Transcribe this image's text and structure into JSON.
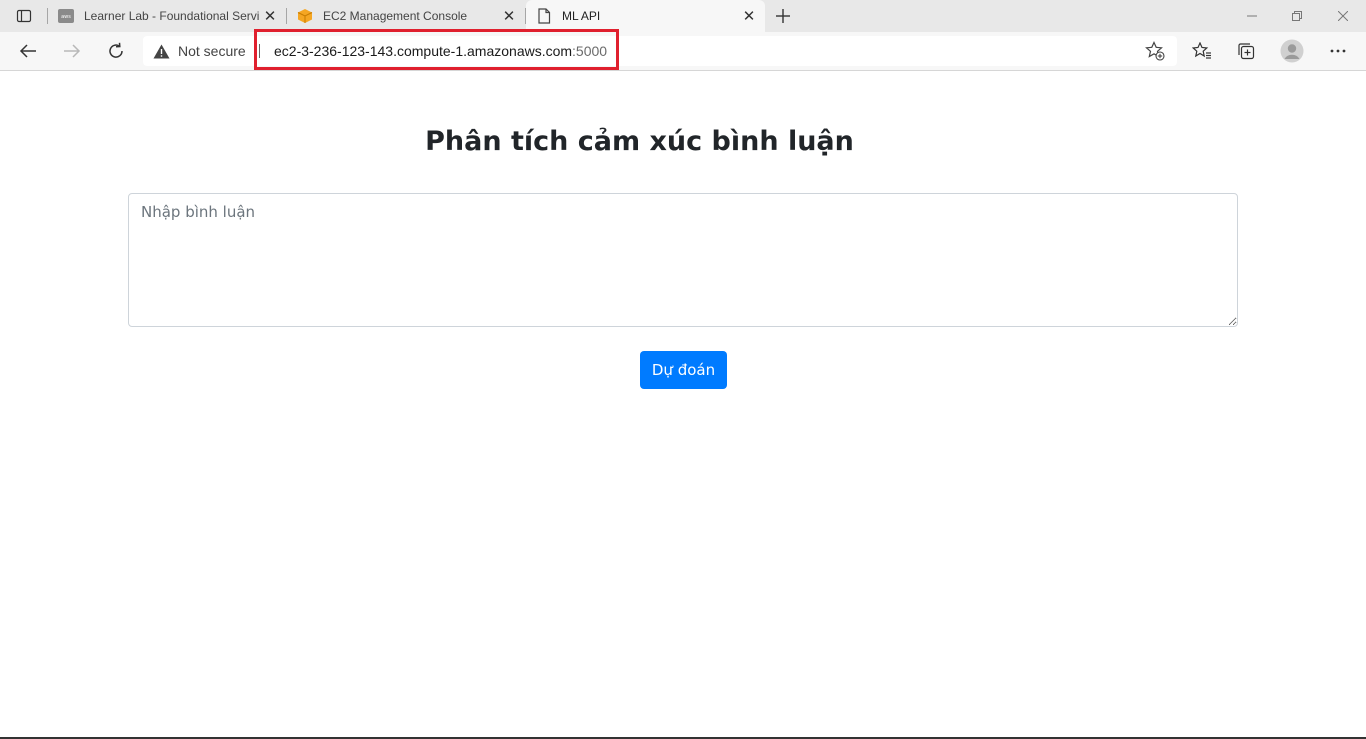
{
  "browser": {
    "tabs": [
      {
        "title": "Learner Lab - Foundational Servi",
        "favicon": "aws-icon",
        "active": false
      },
      {
        "title": "EC2 Management Console",
        "favicon": "ec2-box-icon",
        "active": false
      },
      {
        "title": "ML API",
        "favicon": "page-icon",
        "active": true
      }
    ],
    "security_label": "Not secure",
    "url_host": "ec2-3-236-123-143.compute-1.amazonaws.com",
    "url_port": ":5000",
    "colors": {
      "highlight": "#e0202e",
      "ec2_favicon": "#f5a623"
    }
  },
  "page": {
    "title": "Phân tích cảm xúc bình luận",
    "comment_placeholder": "Nhập bình luận",
    "comment_value": "",
    "predict_label": "Dự đoán",
    "colors": {
      "button": "#007bff",
      "heading": "#212529"
    }
  }
}
